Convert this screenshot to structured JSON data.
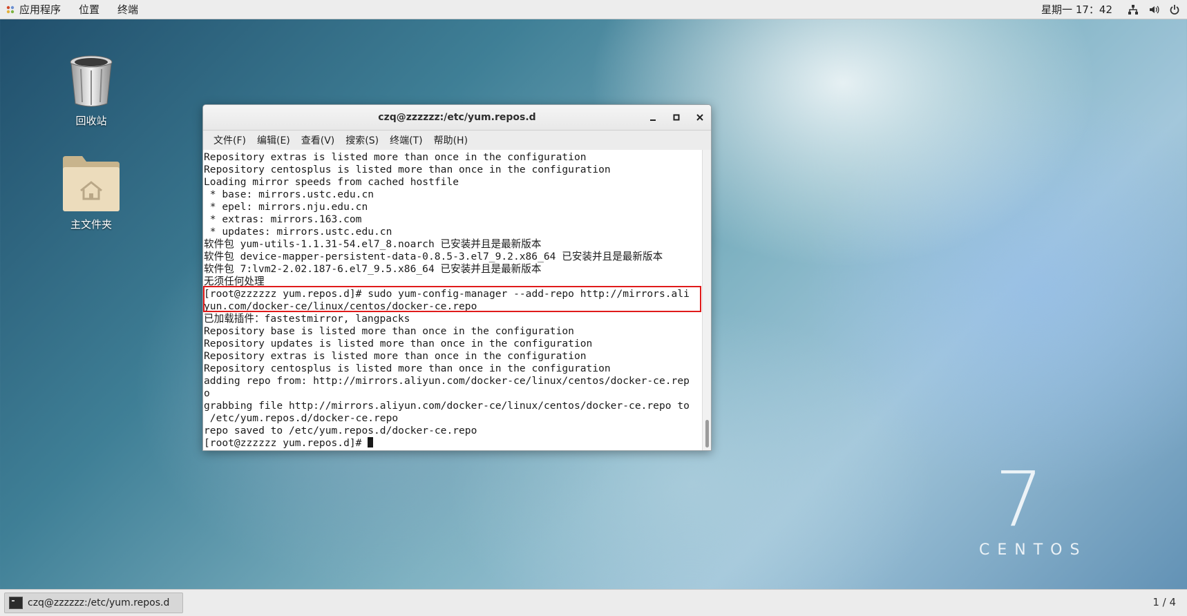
{
  "topbar": {
    "apps_label": "应用程序",
    "places_label": "位置",
    "terminal_label": "终端",
    "clock": "星期一 17：42",
    "icons": [
      "network-icon",
      "volume-icon",
      "power-icon"
    ]
  },
  "desktop": {
    "trash_label": "回收站",
    "home_label": "主文件夹",
    "brand_number": "7",
    "brand_name": "CENTOS"
  },
  "window": {
    "title": "czq@zzzzzz:/etc/yum.repos.d",
    "menus": [
      "文件(F)",
      "编辑(E)",
      "查看(V)",
      "搜索(S)",
      "终端(T)",
      "帮助(H)"
    ],
    "terminal_lines": [
      "Repository extras is listed more than once in the configuration",
      "Repository centosplus is listed more than once in the configuration",
      "Loading mirror speeds from cached hostfile",
      " * base: mirrors.ustc.edu.cn",
      " * epel: mirrors.nju.edu.cn",
      " * extras: mirrors.163.com",
      " * updates: mirrors.ustc.edu.cn",
      "软件包 yum-utils-1.1.31-54.el7_8.noarch 已安装并且是最新版本",
      "软件包 device-mapper-persistent-data-0.8.5-3.el7_9.2.x86_64 已安装并且是最新版本",
      "软件包 7:lvm2-2.02.187-6.el7_9.5.x86_64 已安装并且是最新版本",
      "无须任何处理",
      "[root@zzzzzz yum.repos.d]# sudo yum-config-manager --add-repo http://mirrors.ali",
      "yun.com/docker-ce/linux/centos/docker-ce.repo",
      "已加载插件：fastestmirror, langpacks",
      "Repository base is listed more than once in the configuration",
      "Repository updates is listed more than once in the configuration",
      "Repository extras is listed more than once in the configuration",
      "Repository centosplus is listed more than once in the configuration",
      "adding repo from: http://mirrors.aliyun.com/docker-ce/linux/centos/docker-ce.rep",
      "o",
      "grabbing file http://mirrors.aliyun.com/docker-ce/linux/centos/docker-ce.repo to",
      " /etc/yum.repos.d/docker-ce.repo",
      "repo saved to /etc/yum.repos.d/docker-ce.repo",
      "[root@zzzzzz yum.repos.d]# "
    ],
    "highlight_color": "#e01a1a"
  },
  "taskbar": {
    "task_label": "czq@zzzzzz:/etc/yum.repos.d",
    "workspace": "1 / 4"
  }
}
